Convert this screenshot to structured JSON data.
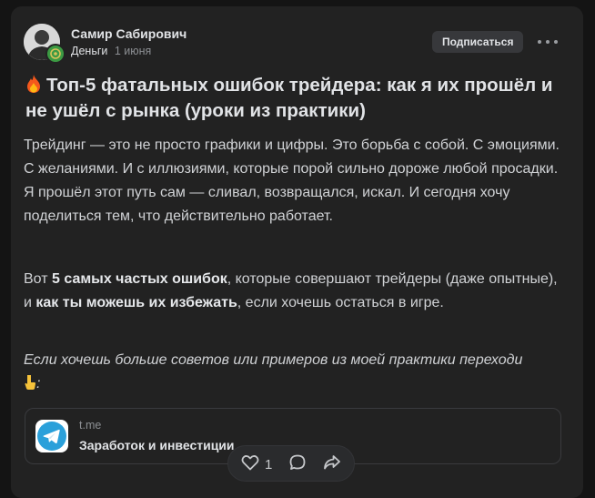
{
  "post": {
    "author": "Самир Сабирович",
    "channel": "Деньги",
    "date": "1 июня",
    "subscribe_label": "Подписаться",
    "title": "Топ-5 фатальных ошибок трейдера: как я их прошёл и не ушёл с рынка (уроки из практики)",
    "paragraph1": "Трейдинг — это не просто графики и цифры. Это борьба с собой. С эмоциями. С желаниями. И с иллюзиями, которые порой сильно дороже любой просадки. Я прошёл этот путь сам — сливал, возвращался, искал. И сегодня хочу поделиться тем, что действительно работает.",
    "paragraph2": {
      "part1": "Вот ",
      "bold1": "5 самых частых ошибок",
      "part2": ", которые совершают трейдеры (даже опытные), и ",
      "bold2": "как ты можешь их избежать",
      "part3": ", если хочешь остаться в игре."
    },
    "paragraph3": "Если хочешь больше советов или примеров из моей практики переходи",
    "paragraph3_end": ":"
  },
  "link_card": {
    "domain": "t.me",
    "title": "Заработок и инвестиции",
    "icon": "telegram-icon"
  },
  "actions": {
    "like_count": "1",
    "like_icon": "heart-icon",
    "comment_icon": "comment-icon",
    "share_icon": "share-icon"
  },
  "colors": {
    "background": "#141414",
    "card": "#222222",
    "text": "#e1e3e6",
    "secondary": "#8c8f93",
    "telegram": "#2aa0da"
  }
}
